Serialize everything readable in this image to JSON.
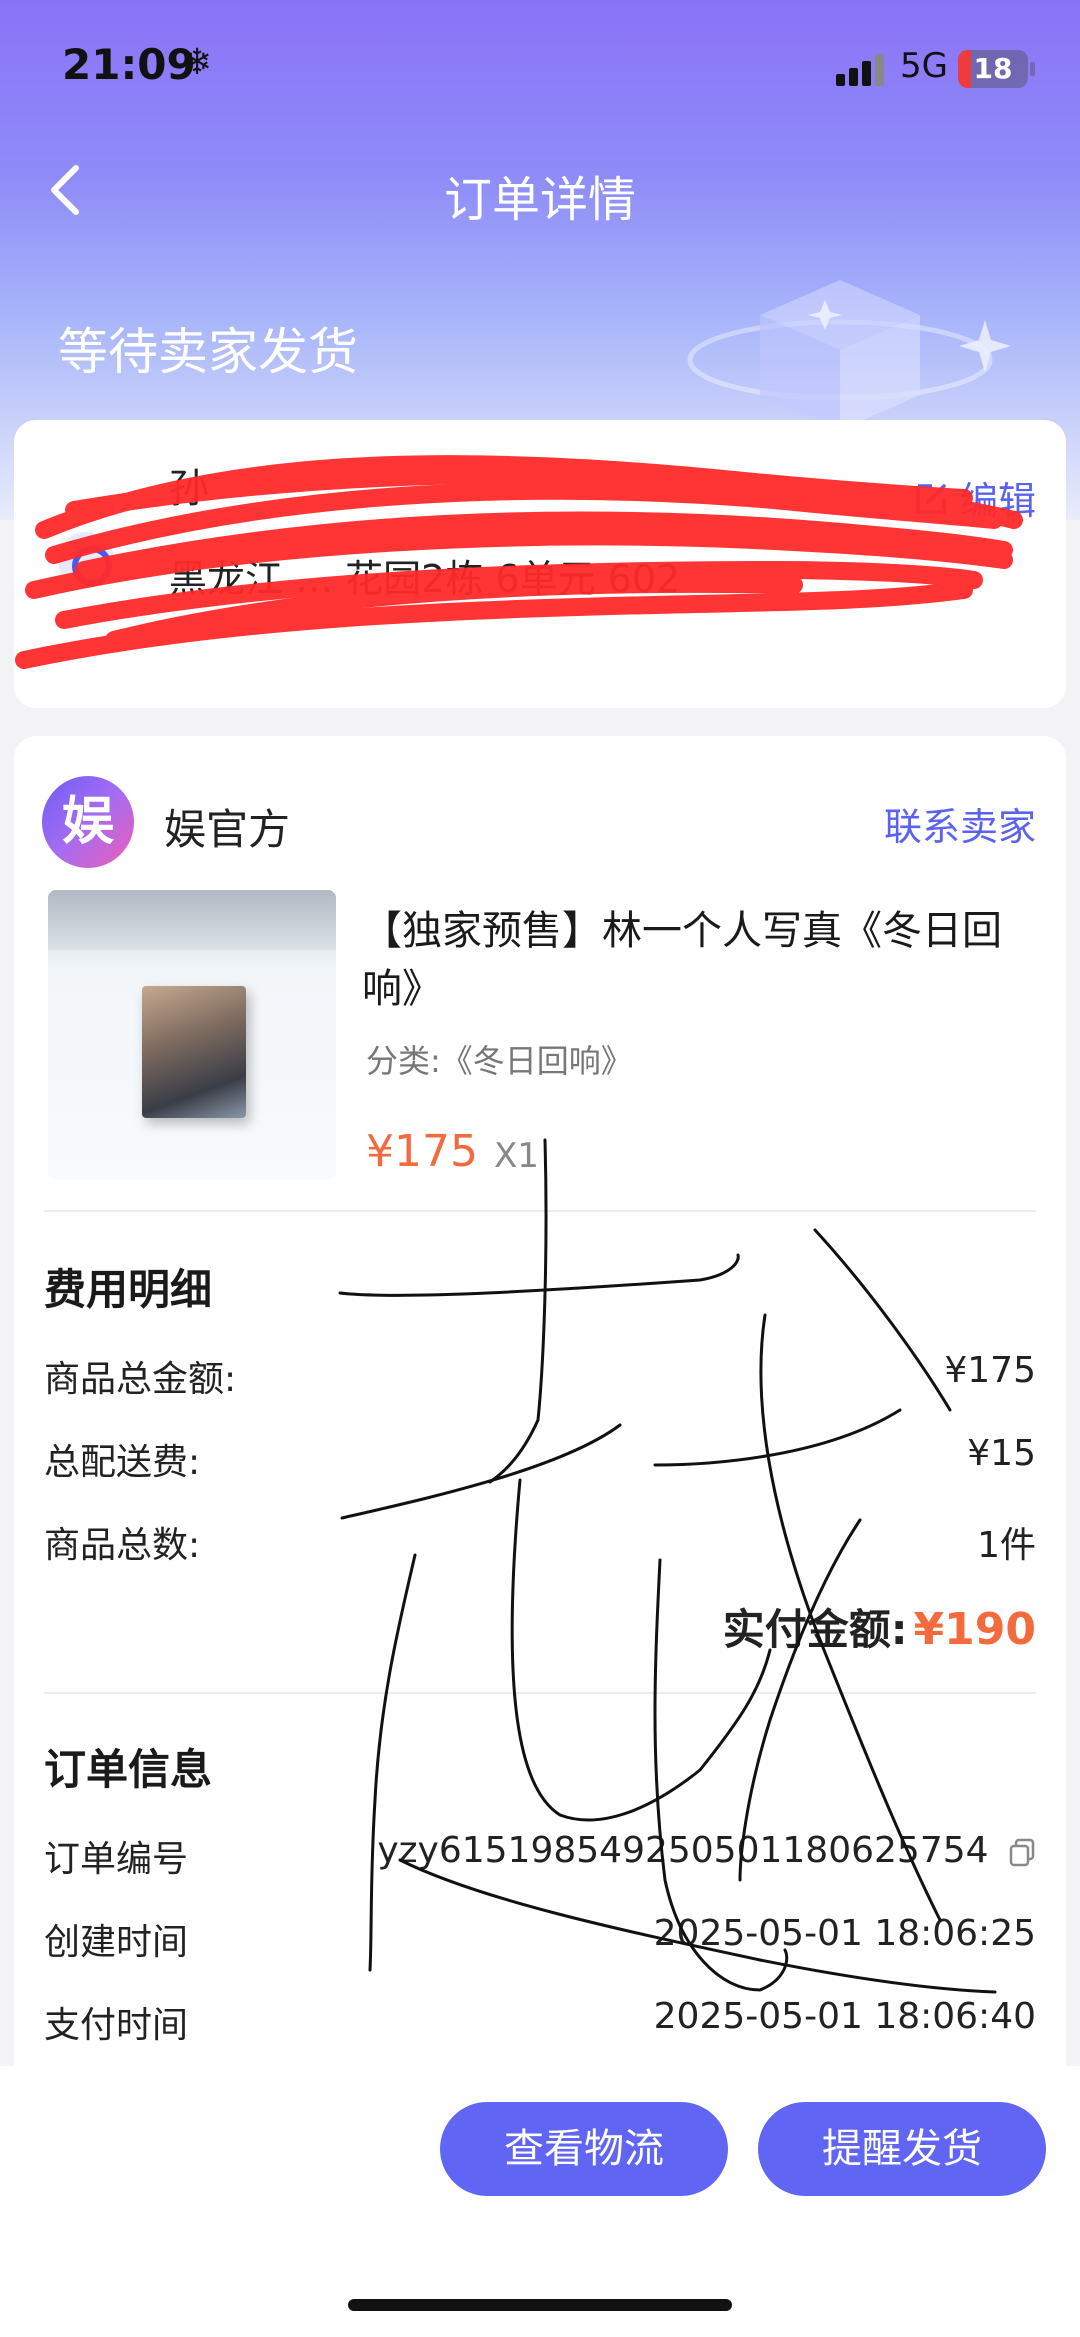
{
  "status_bar": {
    "time": "21:09",
    "network": "5G",
    "battery": "18",
    "battery_level": 0.18
  },
  "header": {
    "title": "订单详情",
    "order_status": "等待卖家发货"
  },
  "address": {
    "name": "孙",
    "line": "黑龙江 … 花园2栋 6单元 602",
    "edit_label": "编辑"
  },
  "shop": {
    "logo_char": "娱",
    "name": "娱官方",
    "contact_label": "联系卖家"
  },
  "product": {
    "title": "【独家预售】林一个人写真《冬日回响》",
    "category": "分类:《冬日回响》",
    "price": "¥175",
    "quantity": "X1"
  },
  "fees": {
    "title": "费用明细",
    "rows": [
      {
        "label": "商品总金额:",
        "value": "¥175"
      },
      {
        "label": "总配送费:",
        "value": "¥15"
      },
      {
        "label": "商品总数:",
        "value": "1件"
      }
    ],
    "paid_label": "实付金额:",
    "paid_value": "¥190"
  },
  "order_info": {
    "title": "订单信息",
    "rows": [
      {
        "label": "订单编号",
        "value": "yzy6151985492505011806257​54"
      },
      {
        "label": "创建时间",
        "value": "2025-05-01 18:06:25"
      },
      {
        "label": "支付时间",
        "value": "2025-05-01 18:06:40"
      }
    ]
  },
  "actions": {
    "logistics": "查看物流",
    "remind": "提醒发货"
  },
  "colors": {
    "accent": "#6066f3",
    "price": "#f36a3d",
    "link": "#5a62f0",
    "redaction": "#ff2a2a"
  }
}
